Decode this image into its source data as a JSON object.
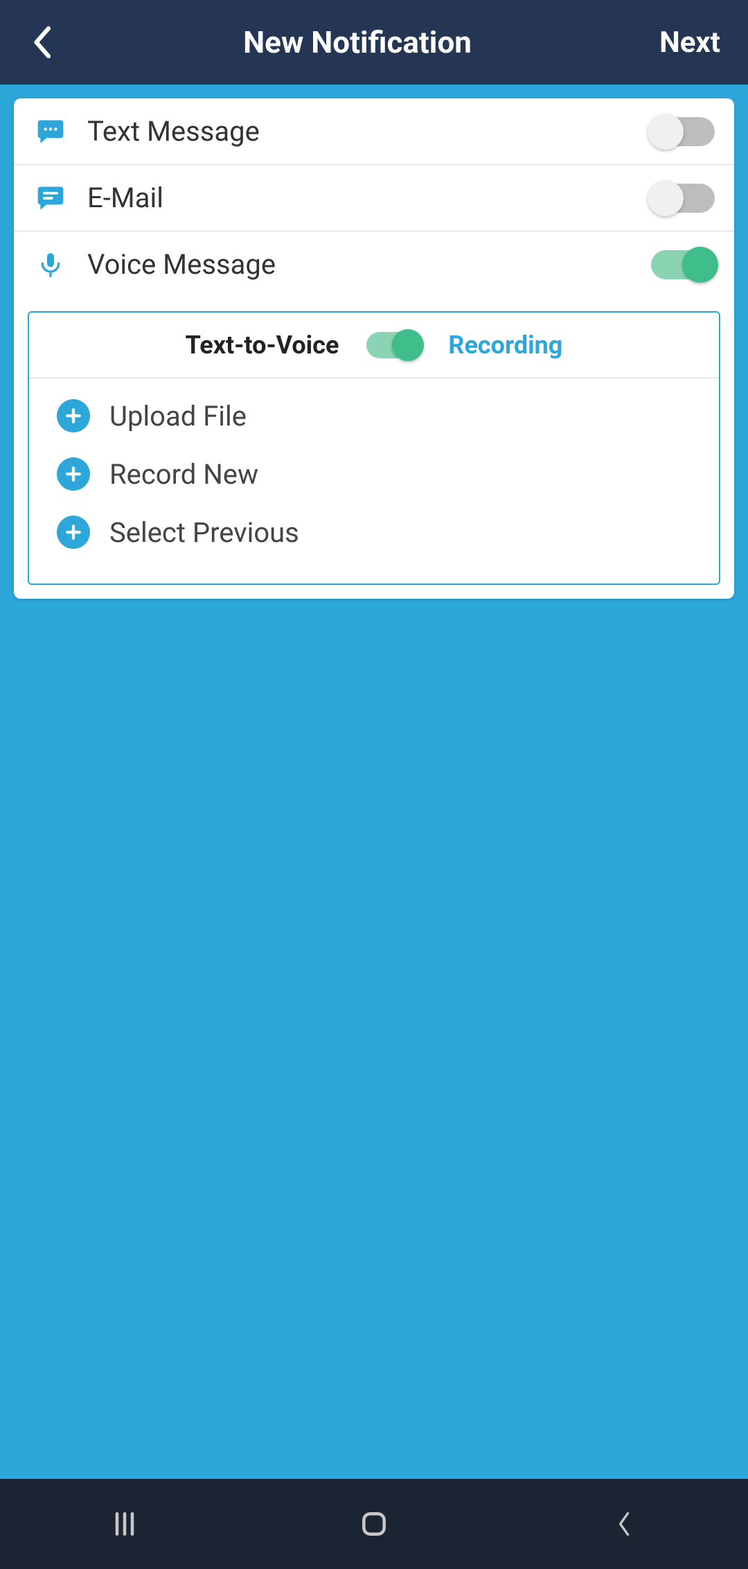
{
  "header": {
    "title": "New Notification",
    "next_label": "Next"
  },
  "channels": {
    "text_message": {
      "label": "Text Message",
      "enabled": false
    },
    "email": {
      "label": "E-Mail",
      "enabled": false
    },
    "voice": {
      "label": "Voice Message",
      "enabled": true
    }
  },
  "voice_mode": {
    "left_label": "Text-to-Voice",
    "right_label": "Recording",
    "selected": "Recording"
  },
  "voice_actions": {
    "upload": "Upload File",
    "record": "Record New",
    "select_previous": "Select Previous"
  }
}
